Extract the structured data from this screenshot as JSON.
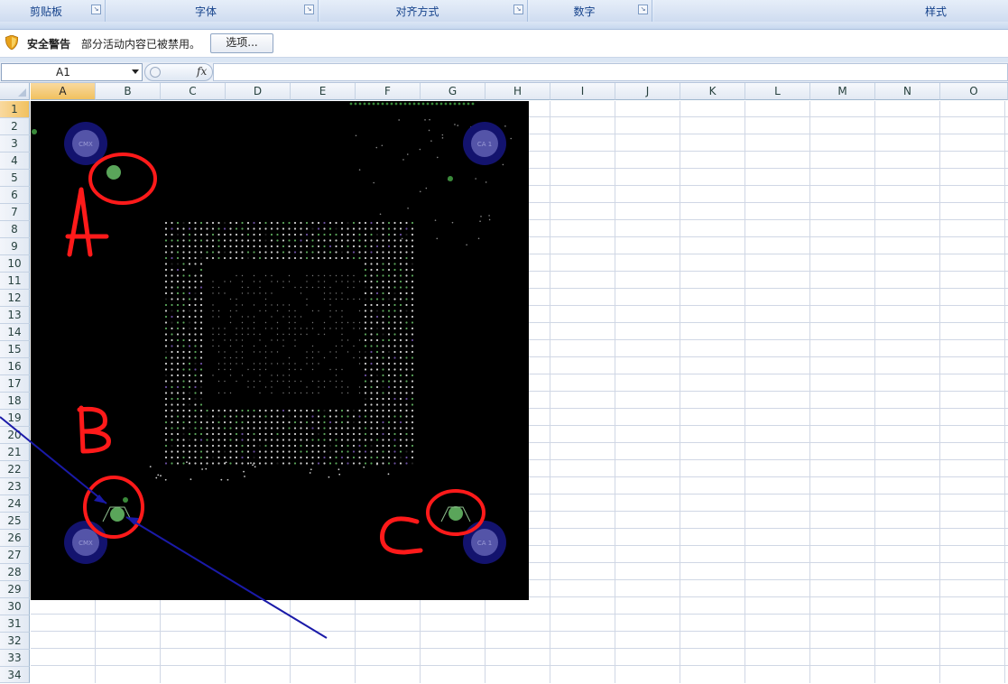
{
  "ribbon": {
    "groups": [
      "剪贴板",
      "字体",
      "对齐方式",
      "数字",
      "样式"
    ]
  },
  "security_bar": {
    "title": "安全警告",
    "message": "部分活动内容已被禁用。",
    "options_button": "选项..."
  },
  "formula_bar": {
    "name_box": "A1",
    "fx_label": "fx",
    "formula": ""
  },
  "columns": [
    "A",
    "B",
    "C",
    "D",
    "E",
    "F",
    "G",
    "H",
    "I",
    "J",
    "K",
    "L",
    "M",
    "N",
    "O"
  ],
  "rows": [
    "1",
    "2",
    "3",
    "4",
    "5",
    "6",
    "7",
    "8",
    "9",
    "10",
    "11",
    "12",
    "13",
    "14",
    "15",
    "16",
    "17",
    "18",
    "19",
    "20",
    "21",
    "22",
    "23",
    "24",
    "25",
    "26",
    "27",
    "28",
    "29",
    "30",
    "31",
    "32",
    "33",
    "34"
  ],
  "selected_cell": "A1",
  "image": {
    "description_icons": "pcb-board-image",
    "labels": {
      "top_left_pad": "CMX",
      "top_right_pad": "CA 1",
      "bottom_left_pad": "CMX",
      "bottom_right_pad": "CA 1"
    },
    "annotations": [
      "A",
      "B",
      "C"
    ],
    "colors": {
      "background": "#000000",
      "marker": "#ff1a1a",
      "arrow": "#1a1aa8",
      "pad_ring": "#13136e",
      "pad_green": "#5aa55a"
    }
  }
}
